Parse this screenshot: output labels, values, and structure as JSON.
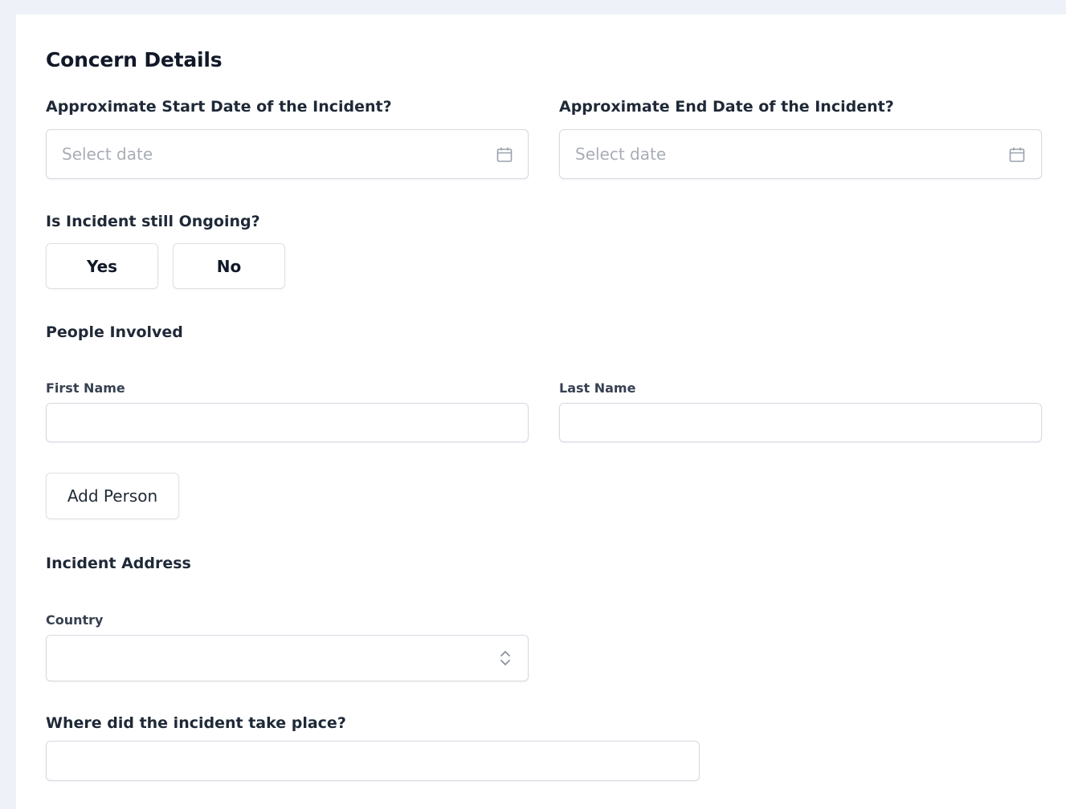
{
  "form": {
    "title": "Concern Details",
    "start_date": {
      "label": "Approximate Start Date of the Incident?",
      "placeholder": "Select date",
      "value": ""
    },
    "end_date": {
      "label": "Approximate End Date of the Incident?",
      "placeholder": "Select date",
      "value": ""
    },
    "ongoing": {
      "label": "Is Incident still Ongoing?",
      "options": [
        "Yes",
        "No"
      ]
    },
    "people": {
      "section_title": "People Involved",
      "first_name": {
        "label": "First Name",
        "value": ""
      },
      "last_name": {
        "label": "Last Name",
        "value": ""
      },
      "add_button": "Add Person"
    },
    "address": {
      "section_title": "Incident Address",
      "country": {
        "label": "Country",
        "value": ""
      }
    },
    "location": {
      "label": "Where did the incident take place?",
      "value": ""
    }
  },
  "icons": {
    "date": "calendar-icon",
    "select": "chevron-up-down-icon"
  }
}
